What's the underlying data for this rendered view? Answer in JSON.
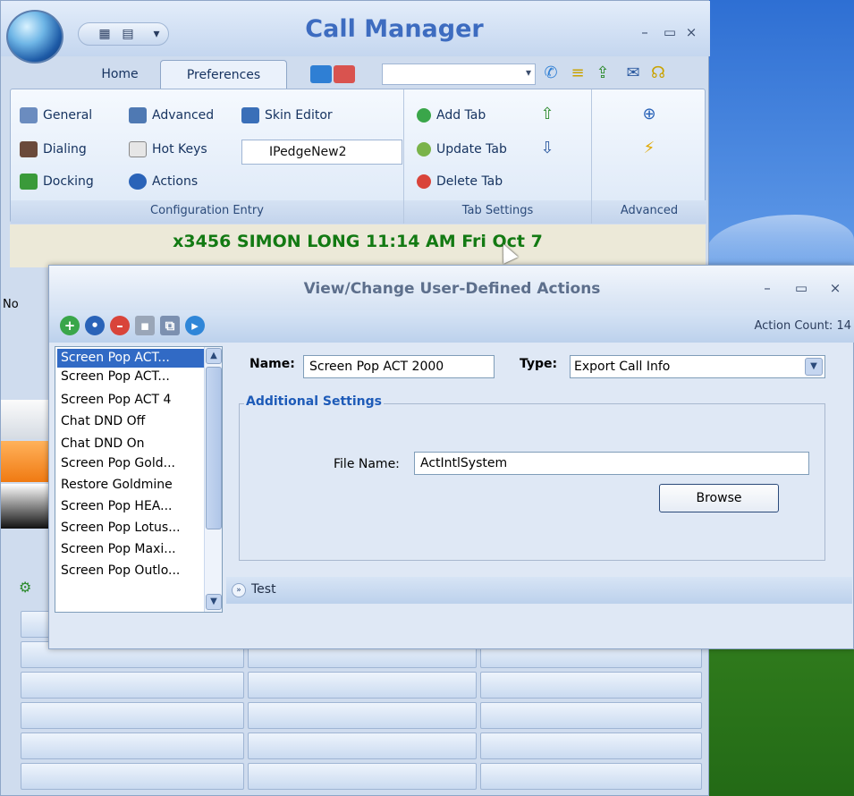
{
  "main_window": {
    "title": "Call Manager",
    "tabs": [
      "Home",
      "Preferences"
    ],
    "ribbon": {
      "configuration": {
        "items": [
          "General",
          "Advanced",
          "Skin Editor",
          "Dialing",
          "Hot Keys",
          "Docking",
          "Actions"
        ],
        "skin_select": "IPedgeNew2",
        "group_label": "Configuration Entry"
      },
      "tab_settings": {
        "items": [
          "Add Tab",
          "Update Tab",
          "Delete Tab"
        ],
        "group_label": "Tab Settings"
      },
      "advanced": {
        "group_label": "Advanced"
      }
    },
    "status": "x3456 SIMON LONG 11:14 AM Fri Oct 7",
    "side_label": "No"
  },
  "dialog": {
    "title": "View/Change User-Defined Actions",
    "action_count": "Action Count: 14",
    "list": [
      "Screen Pop ACT...",
      "Screen Pop ACT...",
      "Screen Pop ACT 4",
      "Chat DND Off",
      "Chat DND On",
      "Screen Pop Gold...",
      "Restore Goldmine",
      "Screen Pop HEA...",
      "Screen Pop Lotus...",
      "Screen Pop Maxi...",
      "Screen Pop Outlo..."
    ],
    "selected_index": 0,
    "name_label": "Name:",
    "name_value": "Screen Pop ACT 2000",
    "type_label": "Type:",
    "type_value": "Export Call Info",
    "additional_settings": "Additional Settings",
    "file_name_label": "File Name:",
    "file_name_value": "ActIntlSystem",
    "browse_label": "Browse",
    "test_label": "Test"
  },
  "icons": {
    "toolbar": [
      "add-icon",
      "edit-icon",
      "delete-icon",
      "save-icon",
      "copy-icon",
      "run-icon"
    ]
  }
}
